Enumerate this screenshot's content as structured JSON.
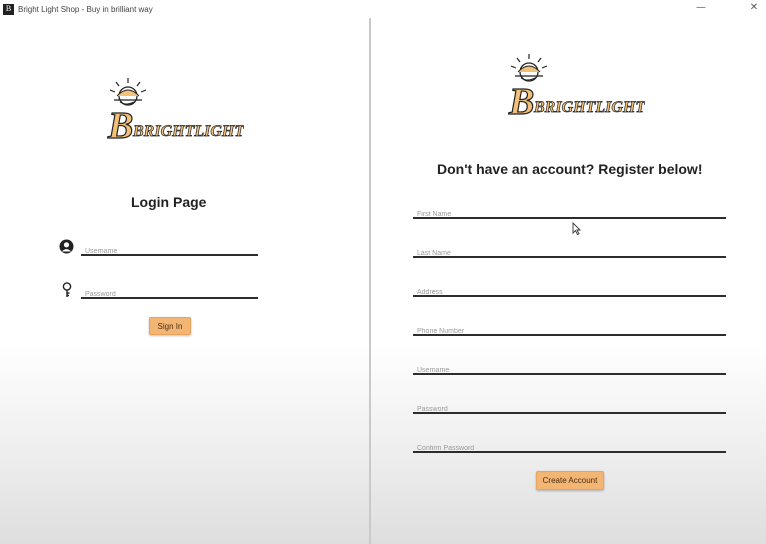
{
  "window": {
    "title": "Bright Light Shop - Buy in brilliant way",
    "app_icon_glyph": "B",
    "minimize_glyph": "—",
    "close_glyph": "✕"
  },
  "brand": {
    "logo_text": "BRIGHTLIGHT",
    "logo_icon": "sun-lamp-logo-icon",
    "accent_color": "#f2b574",
    "logo_fill": "#f3c078"
  },
  "login": {
    "title": "Login Page",
    "username": {
      "placeholder": "Username",
      "value": "",
      "icon": "user-icon"
    },
    "password": {
      "placeholder": "Password",
      "value": "",
      "icon": "key-icon"
    },
    "submit_label": "Sign In"
  },
  "register": {
    "title": "Don't have an account? Register below!",
    "fields": [
      {
        "placeholder": "First Name",
        "value": ""
      },
      {
        "placeholder": "Last Name",
        "value": ""
      },
      {
        "placeholder": "Address",
        "value": ""
      },
      {
        "placeholder": "Phone Number",
        "value": ""
      },
      {
        "placeholder": "Username",
        "value": ""
      },
      {
        "placeholder": "Password",
        "value": ""
      },
      {
        "placeholder": "Confirm Password",
        "value": ""
      }
    ],
    "submit_label": "Create Account"
  }
}
